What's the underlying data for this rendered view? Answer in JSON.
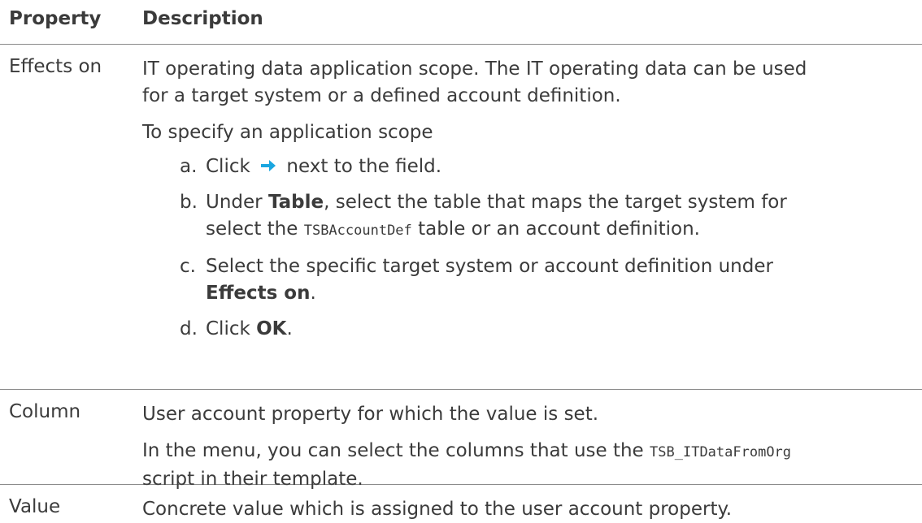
{
  "header": {
    "property": "Property",
    "description": "Description"
  },
  "rows": [
    {
      "property": "Effects on",
      "desc_p1": "IT operating data application scope. The IT operating data can be used",
      "desc_p1b": "for a target system or a defined account definition.",
      "desc_p2": "To specify an application scope",
      "steps": [
        {
          "mark": "a.",
          "pre": "Click ",
          "icon": "right-arrow-icon",
          "post": " next to the field."
        },
        {
          "mark": "b.",
          "pre": "Under ",
          "bold": "Table",
          "post": ", select the table that maps the target system for",
          "line2_pre": "select the ",
          "line2_mono": "TSBAccountDef",
          "line2_post": " table or an account definition."
        },
        {
          "mark": "c.",
          "line1": "Select the specific target system or account definition under",
          "line2_bold": "Effects on",
          "line2_post": "."
        },
        {
          "mark": "d.",
          "pre": "Click ",
          "bold": "OK",
          "post": "."
        }
      ]
    },
    {
      "property": "Column",
      "desc_p1": "User account property for which the value is set.",
      "desc_p2_pre": "In the menu, you can select the columns that use the ",
      "desc_p2_mono": "TSB_ITDataFromOrg",
      "desc_p2_line2": "script in their template."
    },
    {
      "property": "Value",
      "desc_p1": "Concrete value which is assigned to the user account property."
    }
  ],
  "colors": {
    "text": "#3b3b3b",
    "rule": "#8a8a8a",
    "arrow": "#1aa6e0"
  }
}
